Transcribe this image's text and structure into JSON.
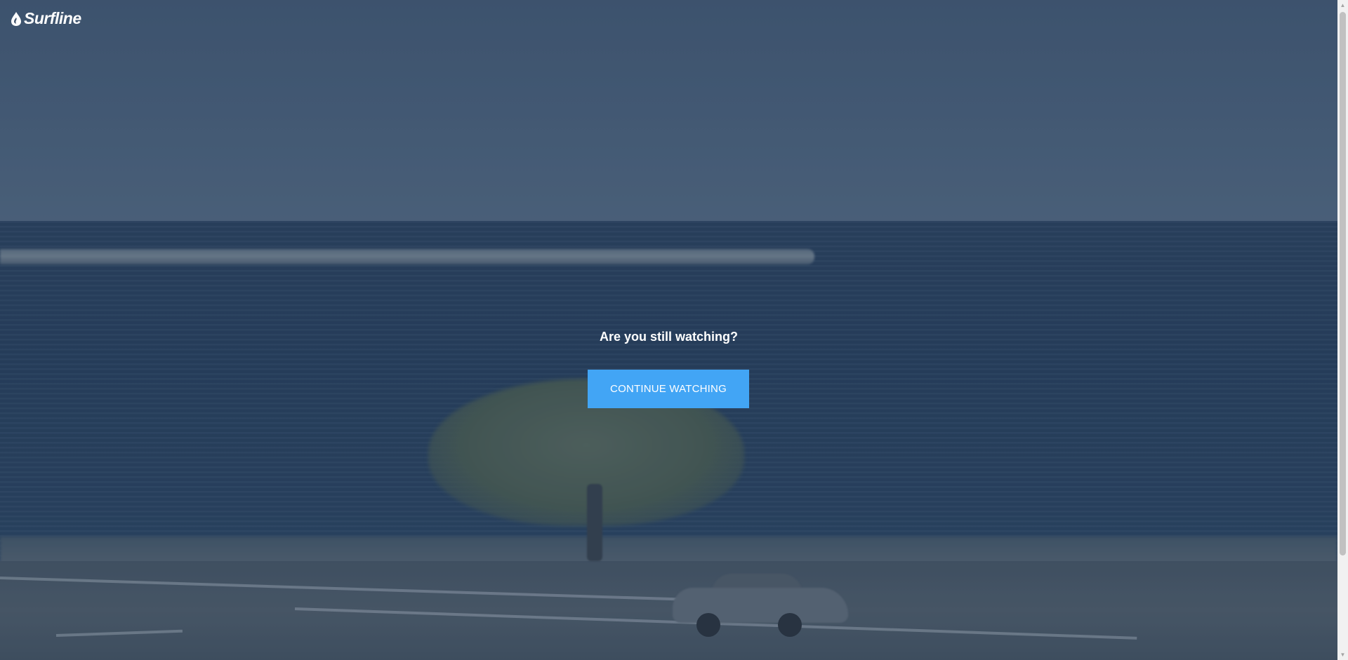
{
  "brand": {
    "name": "Surfline"
  },
  "modal": {
    "prompt": "Are you still watching?",
    "button_label": "CONTINUE WATCHING",
    "button_color": "#42a5f5"
  },
  "scrollbar": {
    "up_icon": "triangle-up-icon",
    "down_icon": "triangle-down-icon"
  }
}
